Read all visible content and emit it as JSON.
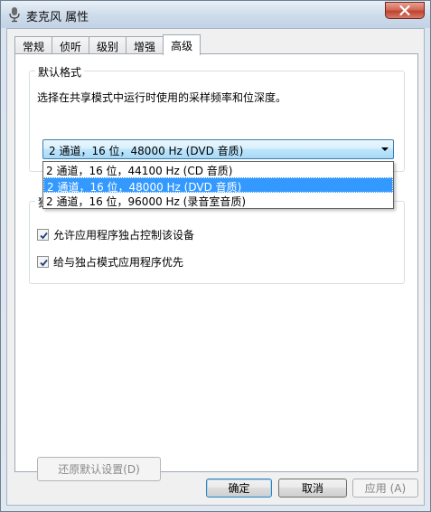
{
  "window": {
    "title": "麦克风 属性"
  },
  "tabs": [
    {
      "label": "常规",
      "active": false
    },
    {
      "label": "侦听",
      "active": false
    },
    {
      "label": "级别",
      "active": false
    },
    {
      "label": "增强",
      "active": false
    },
    {
      "label": "高级",
      "active": true
    }
  ],
  "default_format": {
    "legend": "默认格式",
    "description": "选择在共享模式中运行时使用的采样频率和位深度。",
    "selected": "2 通道，16 位，48000 Hz (DVD 音质)",
    "options": [
      "2 通道，16 位，44100 Hz (CD 音质)",
      "2 通道，16 位，48000 Hz (DVD 音质)",
      "2 通道，16 位，96000 Hz (录音室音质)"
    ]
  },
  "exclusive_mode": {
    "legend_partial": "独",
    "allow_label": "允许应用程序独占控制该设备",
    "allow_checked": true,
    "priority_label": "给与独占模式应用程序优先",
    "priority_checked": true
  },
  "buttons": {
    "restore": "还原默认设置(D)",
    "ok": "确定",
    "cancel": "取消",
    "apply": "应用 (A)"
  },
  "colors": {
    "selection": "#3399ff",
    "combo_border": "#3c7fb1"
  }
}
